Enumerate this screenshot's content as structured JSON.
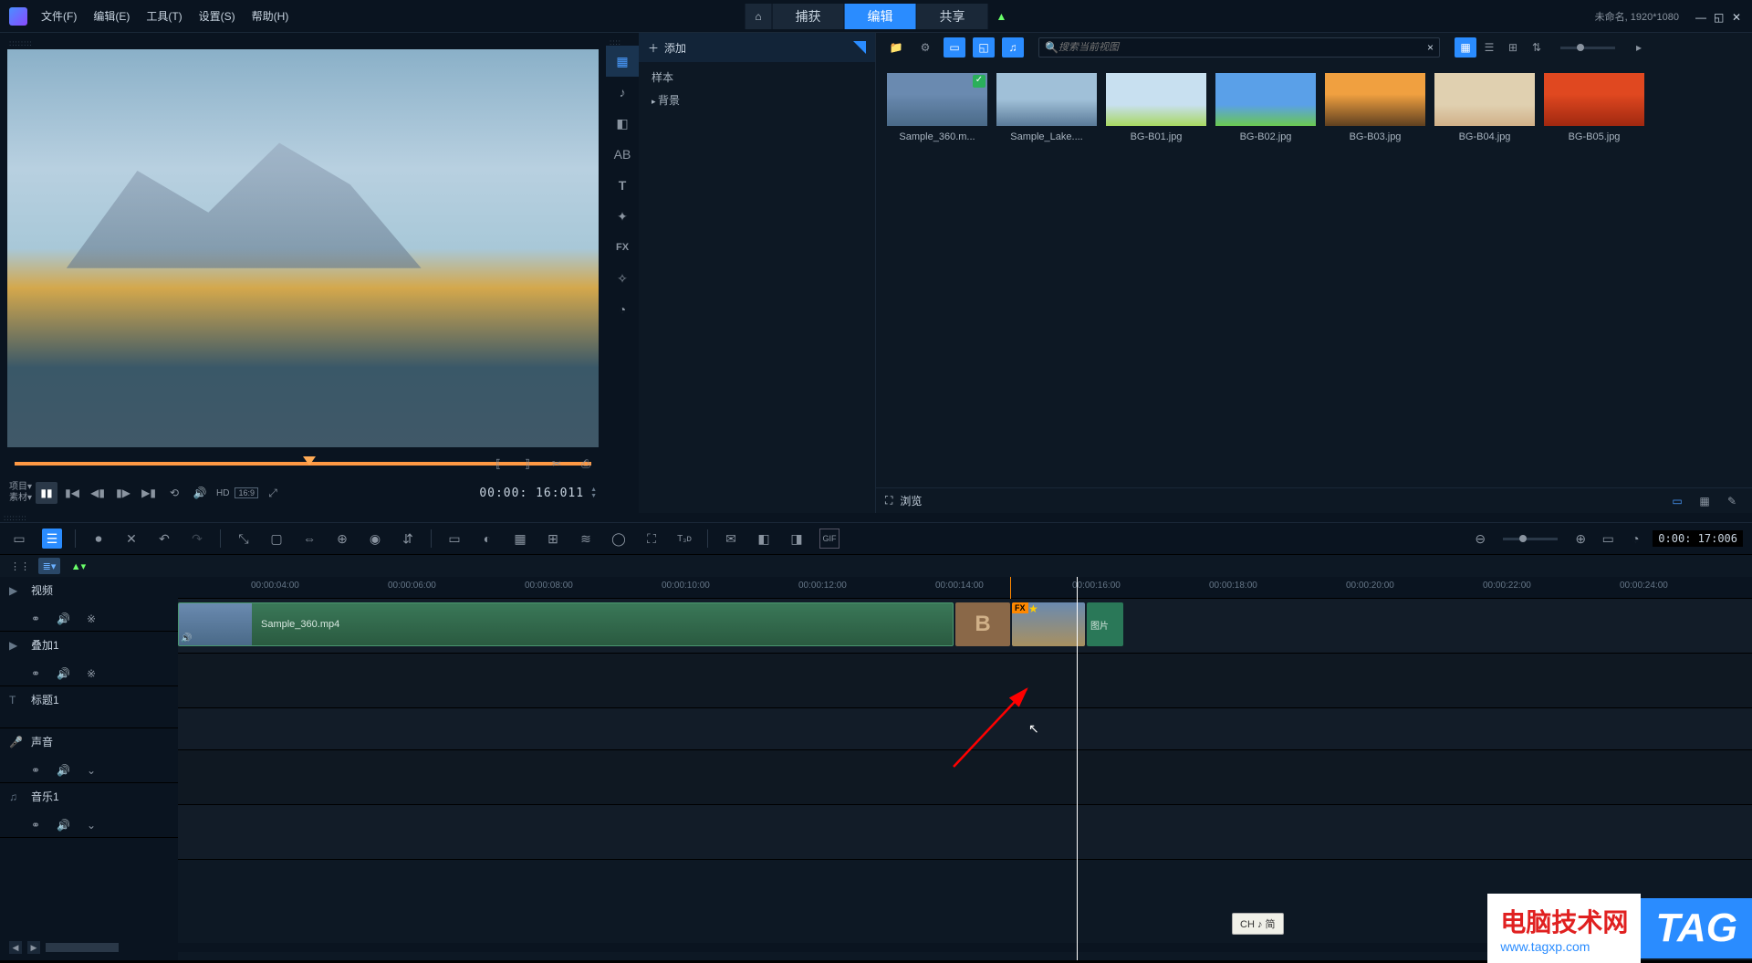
{
  "menu": {
    "file": "文件(F)",
    "edit": "编辑(E)",
    "tools": "工具(T)",
    "settings": "设置(S)",
    "help": "帮助(H)"
  },
  "modes": {
    "capture": "捕获",
    "edit": "编辑",
    "share": "共享"
  },
  "project": {
    "info": "未命名, 1920*1080"
  },
  "preview": {
    "labels": {
      "project": "项目▾",
      "clip": "素材▾"
    },
    "hd": "HD",
    "ratio": "16:9",
    "timecode": "00:00: 16:011"
  },
  "library": {
    "add": "添加",
    "tree": {
      "sample": "样本",
      "background": "背景"
    },
    "search_placeholder": "搜索当前视图",
    "items": [
      {
        "name": "Sample_360.m..."
      },
      {
        "name": "Sample_Lake...."
      },
      {
        "name": "BG-B01.jpg"
      },
      {
        "name": "BG-B02.jpg"
      },
      {
        "name": "BG-B03.jpg"
      },
      {
        "name": "BG-B04.jpg"
      },
      {
        "name": "BG-B05.jpg"
      }
    ],
    "browse": "浏览"
  },
  "timeline": {
    "current_time": "0:00: 17:006",
    "ruler": [
      "00:00:04:00",
      "00:00:06:00",
      "00:00:08:00",
      "00:00:10:00",
      "00:00:12:00",
      "00:00:14:00",
      "00:00:16:00",
      "00:00:18:00",
      "00:00:20:00",
      "00:00:22:00",
      "00:00:24:00"
    ],
    "tracks": {
      "video": "视频",
      "overlay": "叠加1",
      "title": "标题1",
      "voice": "声音",
      "music": "音乐1"
    },
    "clips": {
      "sample": "Sample_360.mp4",
      "trans": "B",
      "fx": "FX",
      "tail": "图片"
    }
  },
  "ime": "CH ♪ 简",
  "watermark": {
    "title": "电脑技术网",
    "url": "www.tagxp.com",
    "tag": "TAG"
  }
}
